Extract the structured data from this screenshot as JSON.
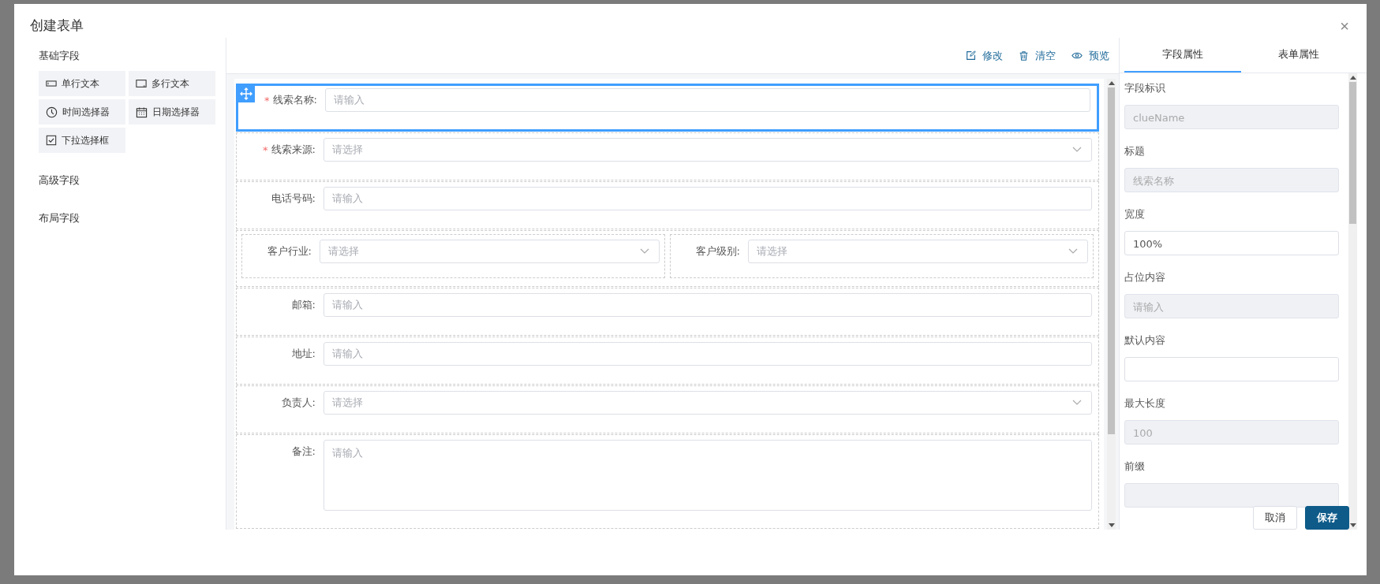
{
  "dialog": {
    "title": "创建表单",
    "close": "×"
  },
  "palette": {
    "sections": [
      {
        "title": "基础字段",
        "items": [
          {
            "label": "单行文本",
            "kind": "single-line"
          },
          {
            "label": "多行文本",
            "kind": "multi-line"
          },
          {
            "label": "时间选择器",
            "kind": "time"
          },
          {
            "label": "日期选择器",
            "kind": "date"
          },
          {
            "label": "下拉选择框",
            "kind": "dropdown"
          }
        ]
      },
      {
        "title": "高级字段"
      },
      {
        "title": "布局字段"
      }
    ]
  },
  "toolbar": [
    {
      "label": "修改",
      "kind": "edit"
    },
    {
      "label": "清空",
      "kind": "clear"
    },
    {
      "label": "预览",
      "kind": "preview"
    }
  ],
  "form_rows": [
    {
      "kind": "input",
      "label": "线索名称:",
      "placeholder": "请输入",
      "required_mark": "*",
      "selected": true
    },
    {
      "kind": "select",
      "label": "线索来源:",
      "placeholder": "请选择",
      "required_mark": "*",
      "selected": false
    },
    {
      "kind": "input",
      "label": "电话号码:",
      "placeholder": "请输入",
      "selected": false
    },
    {
      "kind": "grid",
      "selected": false,
      "columns": [
        {
          "kind": "select",
          "label": "客户行业:",
          "placeholder": "请选择"
        },
        {
          "kind": "select",
          "label": "客户级别:",
          "placeholder": "请选择"
        }
      ]
    },
    {
      "kind": "input",
      "label": "邮箱:",
      "placeholder": "请输入",
      "selected": false
    },
    {
      "kind": "input",
      "label": "地址:",
      "placeholder": "请输入",
      "selected": false
    },
    {
      "kind": "select",
      "label": "负责人:",
      "placeholder": "请选择",
      "selected": false
    },
    {
      "kind": "textarea",
      "label": "备注:",
      "placeholder": "请输入",
      "selected": false
    }
  ],
  "properties": {
    "tabs": [
      {
        "label": "字段属性",
        "selected": true
      },
      {
        "label": "表单属性",
        "selected": false
      }
    ],
    "fields": [
      {
        "label": "字段标识",
        "value": "clueName",
        "disabled": true
      },
      {
        "label": "标题",
        "value": "线索名称",
        "disabled": true
      },
      {
        "label": "宽度",
        "value": "100%",
        "disabled": false
      },
      {
        "label": "占位内容",
        "value": "请输入",
        "disabled": true
      },
      {
        "label": "默认内容",
        "disabled": false
      },
      {
        "label": "最大长度",
        "value": "100",
        "disabled": true
      },
      {
        "label": "前缀",
        "disabled": true
      }
    ]
  },
  "footer": {
    "buttons": [
      {
        "label": "取消",
        "kind": "secondary"
      },
      {
        "label": "保存",
        "kind": "primary"
      }
    ]
  }
}
